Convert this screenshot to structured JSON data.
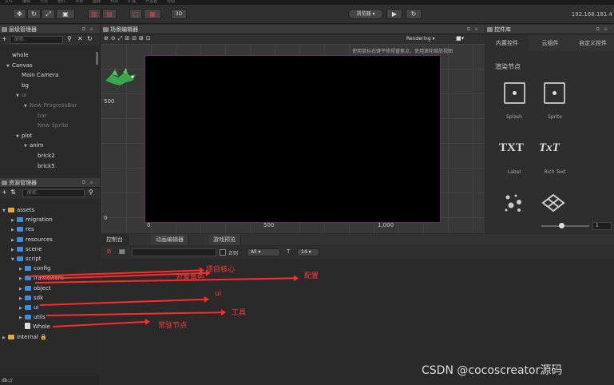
{
  "menubar": {
    "items": [
      "文件",
      "编辑",
      "节点",
      "组件",
      "项目",
      "面板",
      "布局",
      "扩展",
      "开发者",
      "帮助"
    ]
  },
  "toolbar": {
    "preview_select": "浏览器 ▾",
    "play_icon": "▶",
    "refresh_icon": "↻",
    "mode_3d": "3D",
    "ip_address": "192.168.181.4"
  },
  "hierarchy": {
    "title": "层级管理器",
    "search_placeholder": "搜索...",
    "nodes": [
      {
        "label": "whole",
        "dim": false,
        "arrow": ""
      },
      {
        "label": "Canvas",
        "dim": false,
        "arrow": "▼"
      },
      {
        "label": "Main Camera",
        "dim": false,
        "arrow": ""
      },
      {
        "label": "bg",
        "dim": false,
        "arrow": ""
      },
      {
        "label": "ui",
        "dim": true,
        "arrow": "▼"
      },
      {
        "label": "New ProgressBar",
        "dim": true,
        "arrow": "▼"
      },
      {
        "label": "bar",
        "dim": true,
        "arrow": ""
      },
      {
        "label": "New Sprite",
        "dim": true,
        "arrow": ""
      },
      {
        "label": "plot",
        "dim": false,
        "arrow": "▼"
      },
      {
        "label": "anim",
        "dim": false,
        "arrow": "▼"
      },
      {
        "label": "brick2",
        "dim": false,
        "arrow": ""
      },
      {
        "label": "brick5",
        "dim": false,
        "arrow": ""
      }
    ]
  },
  "assets": {
    "title": "资源管理器",
    "search_placeholder": "搜索...",
    "items": [
      {
        "label": "assets",
        "arrow": "▼",
        "kind": "gold"
      },
      {
        "label": "migration",
        "arrow": "▶",
        "kind": "blue"
      },
      {
        "label": "res",
        "arrow": "▶",
        "kind": "blue"
      },
      {
        "label": "resources",
        "arrow": "▶",
        "kind": "blue"
      },
      {
        "label": "scene",
        "arrow": "▶",
        "kind": "blue"
      },
      {
        "label": "script",
        "arrow": "▼",
        "kind": "blue"
      },
      {
        "label": "config",
        "arrow": "▶",
        "kind": "blue"
      },
      {
        "label": "framework",
        "arrow": "▶",
        "kind": "blue"
      },
      {
        "label": "object",
        "arrow": "▶",
        "kind": "blue"
      },
      {
        "label": "sdk",
        "arrow": "▶",
        "kind": "blue"
      },
      {
        "label": "ui",
        "arrow": "▶",
        "kind": "blue"
      },
      {
        "label": "utils",
        "arrow": "▶",
        "kind": "blue"
      },
      {
        "label": "Whole",
        "arrow": "",
        "kind": "file"
      },
      {
        "label": "internal 🔒",
        "arrow": "▶",
        "kind": "gold"
      }
    ],
    "footer": "db://"
  },
  "scene": {
    "title": "场景编辑器",
    "render_mode": "Rendering ▾",
    "hint": "使用鼠标右键平移视窗焦点，使用滚轮缩放视图",
    "ruler_y": [
      "500",
      "0"
    ],
    "ruler_x": [
      "0",
      "500",
      "1,000"
    ]
  },
  "bottom": {
    "tabs": [
      "控制台",
      "动画编辑器",
      "游戏预览"
    ],
    "regex_label": "正则",
    "filter_value": "All",
    "font_size": "14"
  },
  "inspector": {
    "title": "控件库",
    "tabs": [
      "内置控件",
      "云组件",
      "自定义控件"
    ],
    "section": "渲染节点",
    "widgets": [
      "Splash",
      "Sprite",
      "Label",
      "Rich Text"
    ],
    "label_icon": "TXT",
    "richtext_icon": "TxT",
    "zoom_value": "1"
  },
  "annotations": {
    "color": "#ff2a2a",
    "labels": [
      "项目核心",
      "对象角色",
      "配置",
      "ui",
      "工具",
      "常驻节点"
    ]
  },
  "watermark": "CSDN @cocoscreator源码"
}
